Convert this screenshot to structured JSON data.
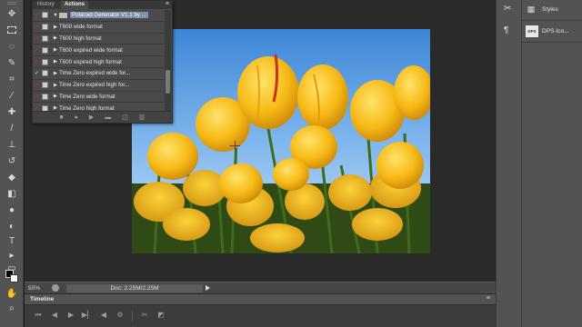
{
  "panel": {
    "tabs": [
      "History",
      "Actions"
    ],
    "menu_icon": "panel-menu-icon",
    "action_set": "Polaroid Generator V1.1 by ...",
    "actions": [
      {
        "label": "T600 wide format",
        "checked": false
      },
      {
        "label": "T600 high format",
        "checked": false
      },
      {
        "label": "T600 expired wide format",
        "checked": false
      },
      {
        "label": "T600 expired high format",
        "checked": false
      },
      {
        "label": "Time Zero expired wide for...",
        "checked": true
      },
      {
        "label": "Time Zero expired high for...",
        "checked": false
      },
      {
        "label": "Time Zero wide format",
        "checked": false
      },
      {
        "label": "Time Zero high format",
        "checked": false
      }
    ],
    "footer_icons": [
      "stop-icon",
      "record-icon",
      "play-icon",
      "new-set-icon",
      "new-action-icon",
      "trash-icon"
    ]
  },
  "status": {
    "zoom": "50%",
    "doc_info": "Doc: 2.25M/2.25M"
  },
  "timeline": {
    "label": "Timeline",
    "controls": [
      "first-frame-icon",
      "prev-frame-icon",
      "play-icon",
      "next-frame-icon",
      "audio-icon",
      "settings-icon",
      "split-icon",
      "transition-icon"
    ]
  },
  "dock": {
    "styles_label": "Styles",
    "file_label": "DPS-Ico...",
    "file_badge": "DPS"
  },
  "colors": {
    "workspace": "#2a2a2a",
    "panel": "#535353",
    "accent": "#7b8fa8",
    "foreground_swatch": "#000000",
    "background_swatch": "#ffffff"
  }
}
